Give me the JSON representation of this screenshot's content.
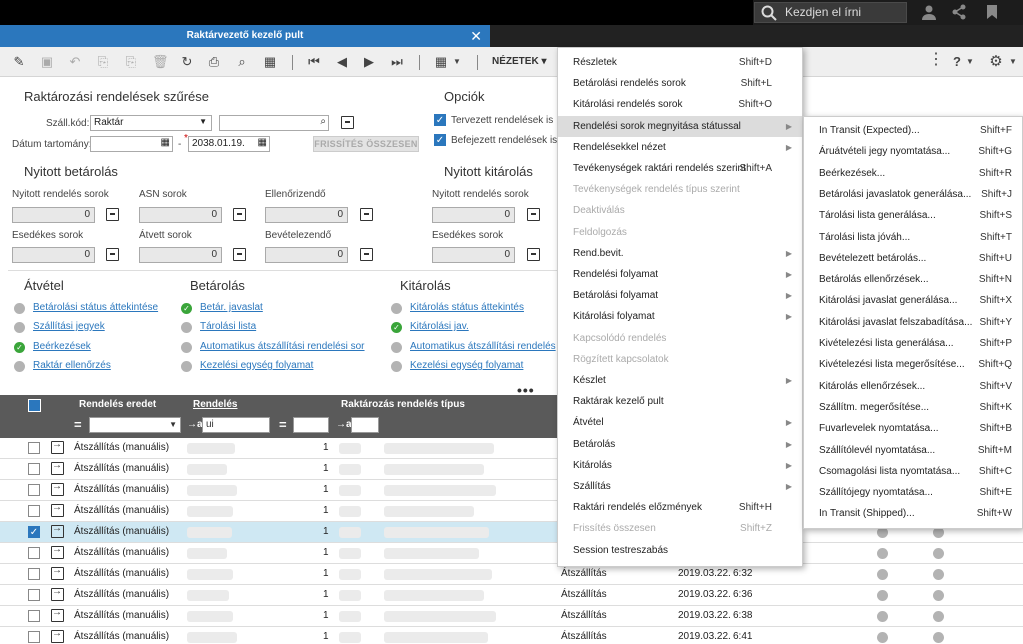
{
  "topbar": {
    "search_placeholder": "Kezdjen el írni"
  },
  "window": {
    "title": "Raktárvezető kezelő pult",
    "close": "✕"
  },
  "toolbar": {
    "views_label": "NÉZETEK"
  },
  "filter": {
    "title": "Raktározási rendelések szűrése",
    "warehouse_label": "Száll.kód:",
    "warehouse_value": "Raktár",
    "date_label": "Dátum tartomány:",
    "date_sep": "-",
    "date_to": "2038.01.19.",
    "refresh_label": "FRISSÍTÉS ÖSSZESEN"
  },
  "options": {
    "title": "Opciók",
    "planned": "Tervezett rendelések is",
    "completed": "Befejezett rendelések is"
  },
  "open_receipts": {
    "title": "Nyitott betárolás",
    "fields": [
      {
        "label": "Nyitott rendelés sorok",
        "value": "0"
      },
      {
        "label": "ASN sorok",
        "value": "0"
      },
      {
        "label": "Ellenőrizendő",
        "value": "0"
      },
      {
        "label": "Esedékes sorok",
        "value": "0"
      },
      {
        "label": "Átvett sorok",
        "value": "0"
      },
      {
        "label": "Bevételezendő",
        "value": "0"
      }
    ]
  },
  "open_issues": {
    "title": "Nyitott kitárolás",
    "fields": [
      {
        "label": "Nyitott rendelés sorok",
        "value": "0"
      },
      {
        "label": "Esedékes sorok",
        "value": "0"
      }
    ]
  },
  "sections": {
    "receipt": {
      "title": "Átvétel",
      "links": [
        "Betárolási státus áttekintése",
        "Szállítási jegyek",
        "Beérkezések",
        "Raktár ellenőrzés"
      ]
    },
    "putaway": {
      "title": "Betárolás",
      "links": [
        "Betár. javaslat",
        "Tárolási lista",
        "Automatikus átszállítási rendelési sor",
        "Kezelési egység folyamat"
      ]
    },
    "issue": {
      "title": "Kitárolás",
      "links": [
        "Kitárolás státus áttekintés",
        "Kitárolási jav.",
        "Automatikus átszállítási rendelés",
        "Kezelési egység folyamat"
      ]
    }
  },
  "grid": {
    "col_origin": "Rendelés eredet",
    "col_order": "Rendelés",
    "col_type": "Raktározás rendelés típus",
    "filter_arrow": "→a",
    "filter_eq": "=",
    "filter_order_value": "ui",
    "rows": [
      {
        "origin": "Átszállítás (manuális)",
        "qty": "1"
      },
      {
        "origin": "Átszállítás (manuális)",
        "qty": "1"
      },
      {
        "origin": "Átszállítás (manuális)",
        "qty": "1"
      },
      {
        "origin": "Átszállítás (manuális)",
        "qty": "1"
      },
      {
        "origin": "Átszállítás (manuális)",
        "qty": "1"
      },
      {
        "origin": "Átszállítás (manuális)",
        "qty": "1"
      },
      {
        "origin": "Átszállítás (manuális)",
        "qty": "1"
      },
      {
        "origin": "Átszállítás (manuális)",
        "qty": "1"
      },
      {
        "origin": "Átszállítás (manuális)",
        "qty": "1"
      },
      {
        "origin": "Átszállítás (manuális)",
        "qty": "1"
      }
    ]
  },
  "right_rows": [
    {
      "type": "Átszállítás",
      "date": "2019.03.22.",
      "time": "6:32"
    },
    {
      "type": "Átszállítás",
      "date": "2019.03.22.",
      "time": "6:36"
    },
    {
      "type": "Átszállítás",
      "date": "2019.03.22.",
      "time": "6:38"
    },
    {
      "type": "Átszállítás",
      "date": "2019.03.22.",
      "time": "6:41"
    }
  ],
  "menu": [
    {
      "label": "Részletek",
      "shortcut": "Shift+D"
    },
    {
      "label": "Betárolási rendelés sorok",
      "shortcut": "Shift+L"
    },
    {
      "label": "Kitárolási rendelés sorok",
      "shortcut": "Shift+O"
    },
    {
      "label": "Rendelési sorok megnyitása státussal",
      "arrow": "▶"
    },
    {
      "label": "Rendelésekkel nézet",
      "arrow": "▶"
    },
    {
      "label": "Tevékenységek raktári rendelés szerint",
      "shortcut": "Shift+A"
    },
    {
      "label": "Tevékenységek rendelés típus szerint"
    },
    {
      "label": "Deaktiválás"
    },
    {
      "label": "Feldolgozás"
    },
    {
      "label": "Rend.bevit.",
      "arrow": "▶"
    },
    {
      "label": "Rendelési folyamat",
      "arrow": "▶"
    },
    {
      "label": "Betárolási folyamat",
      "arrow": "▶"
    },
    {
      "label": "Kitárolási folyamat",
      "arrow": "▶"
    },
    {
      "label": "Kapcsolódó rendelés"
    },
    {
      "label": "Rögzített kapcsolatok"
    },
    {
      "label": "Készlet",
      "arrow": "▶"
    },
    {
      "label": "Raktárak kezelő pult"
    },
    {
      "label": "Átvétel",
      "arrow": "▶"
    },
    {
      "label": "Betárolás",
      "arrow": "▶"
    },
    {
      "label": "Kitárolás",
      "arrow": "▶"
    },
    {
      "label": "Szállítás",
      "arrow": "▶"
    },
    {
      "label": "Raktári rendelés előzmények",
      "shortcut": "Shift+H"
    },
    {
      "label": "Frissítés összesen",
      "shortcut": "Shift+Z"
    },
    {
      "label": "Session testreszabás"
    }
  ],
  "submenu": [
    {
      "label": "In Transit (Expected)...",
      "shortcut": "Shift+F"
    },
    {
      "label": "Áruátvételi jegy nyomtatása...",
      "shortcut": "Shift+G"
    },
    {
      "label": "Beérkezések...",
      "shortcut": "Shift+R"
    },
    {
      "label": "Betárolási javaslatok generálása...",
      "shortcut": "Shift+J"
    },
    {
      "label": "Tárolási lista generálása...",
      "shortcut": "Shift+S"
    },
    {
      "label": "Tárolási lista jóváh...",
      "shortcut": "Shift+T"
    },
    {
      "label": "Bevételezett betárolás...",
      "shortcut": "Shift+U"
    },
    {
      "label": "Betárolás ellenőrzések...",
      "shortcut": "Shift+N"
    },
    {
      "label": "Kitárolási javaslat generálása...",
      "shortcut": "Shift+X"
    },
    {
      "label": "Kitárolási javaslat felszabadítása...",
      "shortcut": "Shift+Y"
    },
    {
      "label": "Kivételezési lista generálása...",
      "shortcut": "Shift+P"
    },
    {
      "label": "Kivételezési lista megerősítése...",
      "shortcut": "Shift+Q"
    },
    {
      "label": "Kitárolás ellenőrzések...",
      "shortcut": "Shift+V"
    },
    {
      "label": "Szállítm. megerősítése...",
      "shortcut": "Shift+K"
    },
    {
      "label": "Fuvarlevelek nyomtatása...",
      "shortcut": "Shift+B"
    },
    {
      "label": "Szállítólevél nyomtatása...",
      "shortcut": "Shift+M"
    },
    {
      "label": "Csomagolási lista nyomtatása...",
      "shortcut": "Shift+C"
    },
    {
      "label": "Szállítójegy nyomtatása...",
      "shortcut": "Shift+E"
    },
    {
      "label": "In Transit (Shipped)...",
      "shortcut": "Shift+W"
    }
  ]
}
